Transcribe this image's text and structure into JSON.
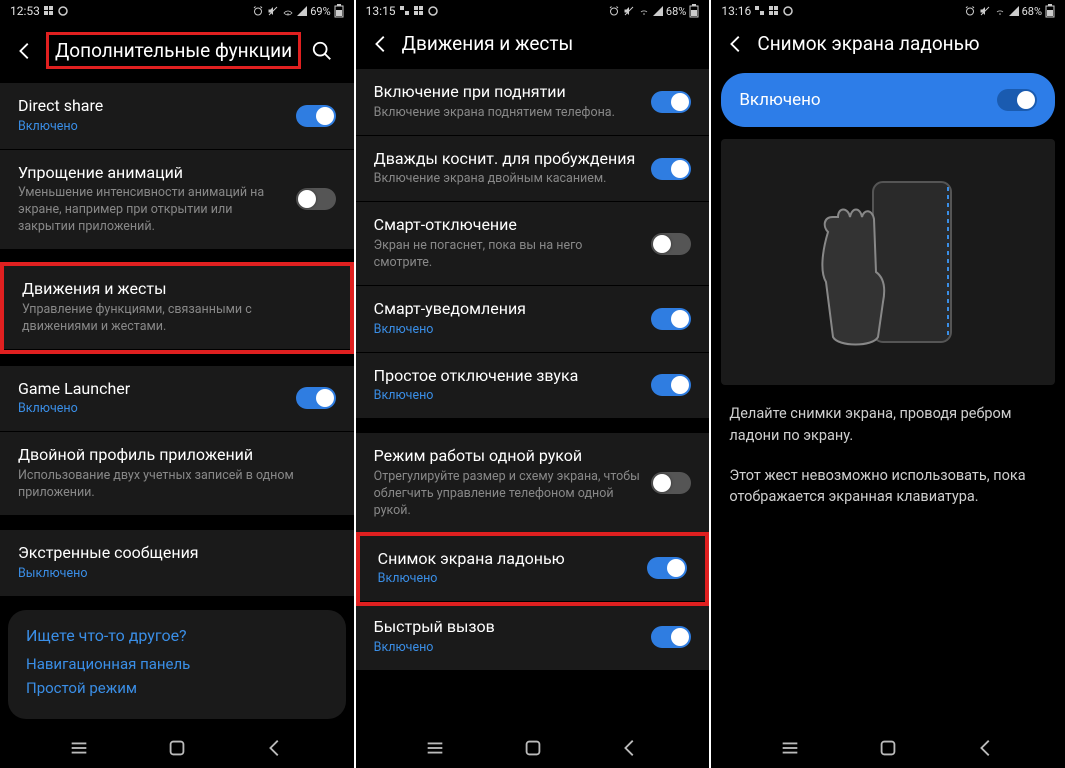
{
  "screen1": {
    "status": {
      "time": "12:53",
      "battery": "69%"
    },
    "title": "Дополнительные функции",
    "items": [
      {
        "title": "Direct share",
        "sub": "Включено",
        "subOn": true,
        "toggle": "on"
      },
      {
        "title": "Упрощение анимаций",
        "sub": "Уменьшение интенсивности анимаций на экране, например при открытии или закрытии приложений.",
        "subOn": false,
        "toggle": "off"
      },
      {
        "title": "Движения и жесты",
        "sub": "Управление функциями, связанными с движениями и жестами.",
        "subOn": false,
        "toggle": null,
        "highlight": true
      },
      {
        "title": "Game Launcher",
        "sub": "Включено",
        "subOn": true,
        "toggle": "on"
      },
      {
        "title": "Двойной профиль приложений",
        "sub": "Использование двух учетных записей в одном приложении.",
        "subOn": false,
        "toggle": null
      },
      {
        "title": "Экстренные сообщения",
        "sub": "Выключено",
        "subOn": true,
        "toggle": null
      }
    ],
    "info": {
      "question": "Ищете что-то другое?",
      "links": [
        "Навигационная панель",
        "Простой режим"
      ]
    }
  },
  "screen2": {
    "status": {
      "time": "13:15",
      "battery": "68%"
    },
    "title": "Движения и жесты",
    "items": [
      {
        "title": "Включение при поднятии",
        "sub": "Включение экрана поднятием телефона.",
        "subOn": false,
        "toggle": "on"
      },
      {
        "title": "Дважды коснит. для пробуждения",
        "sub": "Включение экрана двойным касанием.",
        "subOn": false,
        "toggle": "on"
      },
      {
        "title": "Смарт-отключение",
        "sub": "Экран не погаснет, пока вы на него смотрите.",
        "subOn": false,
        "toggle": "off"
      },
      {
        "title": "Смарт-уведомления",
        "sub": "Включено",
        "subOn": true,
        "toggle": "on"
      },
      {
        "title": "Простое отключение звука",
        "sub": "Включено",
        "subOn": true,
        "toggle": "on"
      },
      {
        "title": "Режим работы одной рукой",
        "sub": "Отрегулируйте размер и схему экрана, чтобы облегчить управление телефоном одной рукой.",
        "subOn": false,
        "toggle": "off"
      },
      {
        "title": "Снимок экрана ладонью",
        "sub": "Включено",
        "subOn": true,
        "toggle": "on",
        "highlight": true
      },
      {
        "title": "Быстрый вызов",
        "sub": "Включено",
        "subOn": true,
        "toggle": "on"
      }
    ]
  },
  "screen3": {
    "status": {
      "time": "13:16",
      "battery": "68%"
    },
    "title": "Снимок экрана ладонью",
    "enabledLabel": "Включено",
    "desc1": "Делайте снимки экрана, проводя ребром ладони по экрану.",
    "desc2": "Этот жест невозможно использовать, пока отображается экранная клавиатура."
  }
}
